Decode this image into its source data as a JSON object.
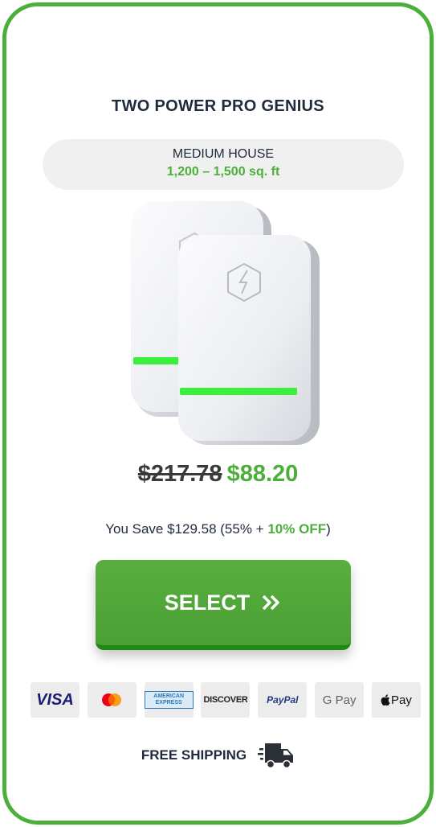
{
  "product": {
    "title": "TWO POWER PRO GENIUS",
    "size_name": "MEDIUM HOUSE",
    "size_range": "1,200 – 1,500 sq. ft",
    "image_icon": "device-image"
  },
  "pricing": {
    "old_price": "$217.78",
    "new_price": "$88.20",
    "savings_prefix": "You Save $129.58 (55% + ",
    "savings_off": "10% OFF",
    "savings_suffix": ")"
  },
  "cta": {
    "label": "SELECT",
    "icon": "double-chevron-right-icon"
  },
  "payments": [
    {
      "name": "visa",
      "label": "VISA"
    },
    {
      "name": "mastercard",
      "label": ""
    },
    {
      "name": "amex",
      "label": "AMERICAN EXPRESS"
    },
    {
      "name": "discover",
      "label": "DISCOVER"
    },
    {
      "name": "paypal",
      "label": "PayPal"
    },
    {
      "name": "google-pay",
      "label": "G Pay"
    },
    {
      "name": "apple-pay",
      "label": "Pay"
    }
  ],
  "shipping": {
    "label": "FREE SHIPPING",
    "icon": "delivery-truck-icon"
  },
  "colors": {
    "accent": "#4caf3c",
    "text": "#1f2a3c",
    "pill_bg": "#f0f0f0"
  }
}
